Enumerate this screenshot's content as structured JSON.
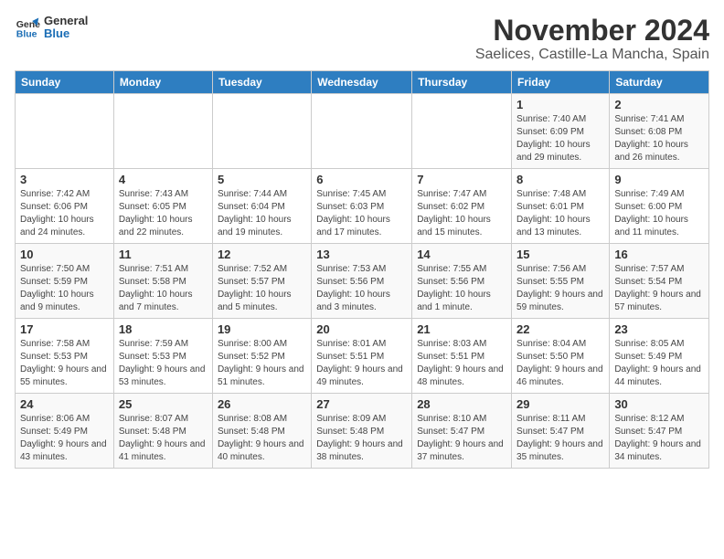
{
  "logo": {
    "general": "General",
    "blue": "Blue"
  },
  "header": {
    "month": "November 2024",
    "location": "Saelices, Castille-La Mancha, Spain"
  },
  "weekdays": [
    "Sunday",
    "Monday",
    "Tuesday",
    "Wednesday",
    "Thursday",
    "Friday",
    "Saturday"
  ],
  "weeks": [
    [
      {
        "day": "",
        "info": ""
      },
      {
        "day": "",
        "info": ""
      },
      {
        "day": "",
        "info": ""
      },
      {
        "day": "",
        "info": ""
      },
      {
        "day": "",
        "info": ""
      },
      {
        "day": "1",
        "info": "Sunrise: 7:40 AM\nSunset: 6:09 PM\nDaylight: 10 hours and 29 minutes."
      },
      {
        "day": "2",
        "info": "Sunrise: 7:41 AM\nSunset: 6:08 PM\nDaylight: 10 hours and 26 minutes."
      }
    ],
    [
      {
        "day": "3",
        "info": "Sunrise: 7:42 AM\nSunset: 6:06 PM\nDaylight: 10 hours and 24 minutes."
      },
      {
        "day": "4",
        "info": "Sunrise: 7:43 AM\nSunset: 6:05 PM\nDaylight: 10 hours and 22 minutes."
      },
      {
        "day": "5",
        "info": "Sunrise: 7:44 AM\nSunset: 6:04 PM\nDaylight: 10 hours and 19 minutes."
      },
      {
        "day": "6",
        "info": "Sunrise: 7:45 AM\nSunset: 6:03 PM\nDaylight: 10 hours and 17 minutes."
      },
      {
        "day": "7",
        "info": "Sunrise: 7:47 AM\nSunset: 6:02 PM\nDaylight: 10 hours and 15 minutes."
      },
      {
        "day": "8",
        "info": "Sunrise: 7:48 AM\nSunset: 6:01 PM\nDaylight: 10 hours and 13 minutes."
      },
      {
        "day": "9",
        "info": "Sunrise: 7:49 AM\nSunset: 6:00 PM\nDaylight: 10 hours and 11 minutes."
      }
    ],
    [
      {
        "day": "10",
        "info": "Sunrise: 7:50 AM\nSunset: 5:59 PM\nDaylight: 10 hours and 9 minutes."
      },
      {
        "day": "11",
        "info": "Sunrise: 7:51 AM\nSunset: 5:58 PM\nDaylight: 10 hours and 7 minutes."
      },
      {
        "day": "12",
        "info": "Sunrise: 7:52 AM\nSunset: 5:57 PM\nDaylight: 10 hours and 5 minutes."
      },
      {
        "day": "13",
        "info": "Sunrise: 7:53 AM\nSunset: 5:56 PM\nDaylight: 10 hours and 3 minutes."
      },
      {
        "day": "14",
        "info": "Sunrise: 7:55 AM\nSunset: 5:56 PM\nDaylight: 10 hours and 1 minute."
      },
      {
        "day": "15",
        "info": "Sunrise: 7:56 AM\nSunset: 5:55 PM\nDaylight: 9 hours and 59 minutes."
      },
      {
        "day": "16",
        "info": "Sunrise: 7:57 AM\nSunset: 5:54 PM\nDaylight: 9 hours and 57 minutes."
      }
    ],
    [
      {
        "day": "17",
        "info": "Sunrise: 7:58 AM\nSunset: 5:53 PM\nDaylight: 9 hours and 55 minutes."
      },
      {
        "day": "18",
        "info": "Sunrise: 7:59 AM\nSunset: 5:53 PM\nDaylight: 9 hours and 53 minutes."
      },
      {
        "day": "19",
        "info": "Sunrise: 8:00 AM\nSunset: 5:52 PM\nDaylight: 9 hours and 51 minutes."
      },
      {
        "day": "20",
        "info": "Sunrise: 8:01 AM\nSunset: 5:51 PM\nDaylight: 9 hours and 49 minutes."
      },
      {
        "day": "21",
        "info": "Sunrise: 8:03 AM\nSunset: 5:51 PM\nDaylight: 9 hours and 48 minutes."
      },
      {
        "day": "22",
        "info": "Sunrise: 8:04 AM\nSunset: 5:50 PM\nDaylight: 9 hours and 46 minutes."
      },
      {
        "day": "23",
        "info": "Sunrise: 8:05 AM\nSunset: 5:49 PM\nDaylight: 9 hours and 44 minutes."
      }
    ],
    [
      {
        "day": "24",
        "info": "Sunrise: 8:06 AM\nSunset: 5:49 PM\nDaylight: 9 hours and 43 minutes."
      },
      {
        "day": "25",
        "info": "Sunrise: 8:07 AM\nSunset: 5:48 PM\nDaylight: 9 hours and 41 minutes."
      },
      {
        "day": "26",
        "info": "Sunrise: 8:08 AM\nSunset: 5:48 PM\nDaylight: 9 hours and 40 minutes."
      },
      {
        "day": "27",
        "info": "Sunrise: 8:09 AM\nSunset: 5:48 PM\nDaylight: 9 hours and 38 minutes."
      },
      {
        "day": "28",
        "info": "Sunrise: 8:10 AM\nSunset: 5:47 PM\nDaylight: 9 hours and 37 minutes."
      },
      {
        "day": "29",
        "info": "Sunrise: 8:11 AM\nSunset: 5:47 PM\nDaylight: 9 hours and 35 minutes."
      },
      {
        "day": "30",
        "info": "Sunrise: 8:12 AM\nSunset: 5:47 PM\nDaylight: 9 hours and 34 minutes."
      }
    ]
  ]
}
